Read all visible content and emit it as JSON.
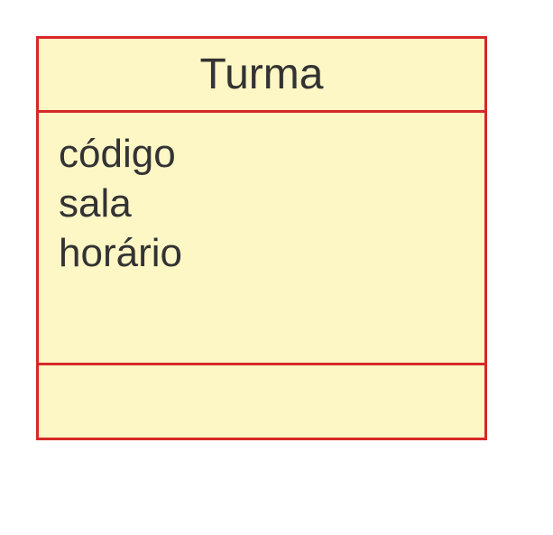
{
  "class": {
    "name": "Turma",
    "attributes": [
      "código",
      "sala",
      "horário"
    ],
    "operations": []
  }
}
